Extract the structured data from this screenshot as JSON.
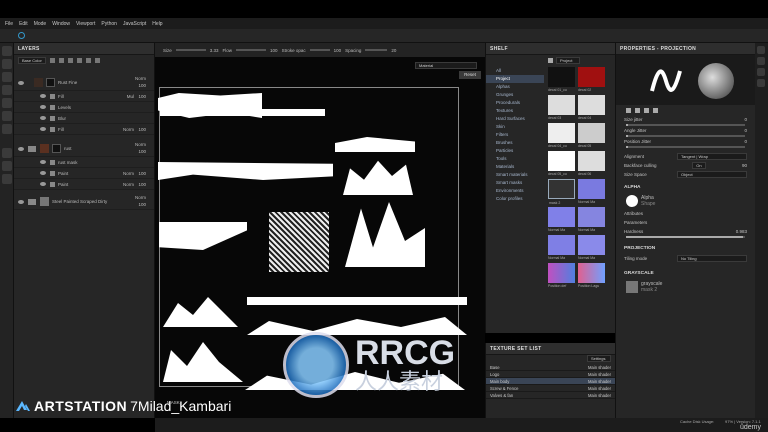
{
  "menu": [
    "File",
    "Edit",
    "Mode",
    "Window",
    "Viewport",
    "Python",
    "JavaScript",
    "Help"
  ],
  "toolbar": {
    "size_label": "Size",
    "size_value": "3.33",
    "flow_label": "Flow",
    "flow_value": "100",
    "stroke_label": "Stroke opac",
    "stroke_value": "100",
    "spacing_label": "Spacing",
    "spacing_value": "20"
  },
  "layers": {
    "title": "LAYERS",
    "blend": "Base Color",
    "items": [
      {
        "name": "Rust Fine",
        "mode": "Norm",
        "opacity": "100",
        "type": "fill"
      },
      {
        "name": "Fill",
        "mode": "Mul",
        "opacity": "100",
        "type": "sub"
      },
      {
        "name": "Levels",
        "mode": "",
        "opacity": "",
        "type": "sub"
      },
      {
        "name": "Blur",
        "mode": "",
        "opacity": "",
        "type": "sub"
      },
      {
        "name": "Fill",
        "mode": "Norm",
        "opacity": "100",
        "type": "sub"
      },
      {
        "name": "rust",
        "mode": "Norm",
        "opacity": "100",
        "type": "folder"
      },
      {
        "name": "rust mask",
        "mode": "",
        "opacity": "",
        "type": "sub"
      },
      {
        "name": "Paint",
        "mode": "Norm",
        "opacity": "100",
        "type": "sub"
      },
      {
        "name": "Paint",
        "mode": "Norm",
        "opacity": "100",
        "type": "sub"
      },
      {
        "name": "Steel Painted Scraped Dirty",
        "mode": "Norm",
        "opacity": "100",
        "type": "folder"
      }
    ]
  },
  "viewport": {
    "mode": "Material",
    "reset": "Reset",
    "mask_label": "MASK"
  },
  "shelf": {
    "title": "SHELF",
    "search": "Project",
    "categories": [
      "All",
      "Project",
      "Alphas",
      "Grunges",
      "Procedurals",
      "Textures",
      "Hard Surfaces",
      "Skin",
      "Filters",
      "Brushes",
      "Particles",
      "Tools",
      "Materials",
      "Smart materials",
      "Smart masks",
      "Environments",
      "Color profiles"
    ],
    "selected": "Project",
    "items": [
      "decal 01_cu",
      "decal 02",
      "decal 03",
      "decal 04",
      "decal 04_cu",
      "decal 05",
      "decal 05_cu",
      "decal 06",
      "mask 2",
      "Normal Ma",
      "Normal Ma",
      "Normal Ma",
      "Normal Ma",
      "Normal Ma",
      "Position def",
      "Position Lagu",
      "Position def",
      "Position def"
    ]
  },
  "texture_sets": {
    "title": "TEXTURE SET LIST",
    "settings": "Settings",
    "rows": [
      {
        "name": "Base",
        "shader": "Main shader"
      },
      {
        "name": "Logo",
        "shader": "Main shader"
      },
      {
        "name": "Main body",
        "shader": "Main shader"
      },
      {
        "name": "Screw & Fence",
        "shader": "Main shader"
      },
      {
        "name": "Valves & fan",
        "shader": "Main shader"
      }
    ]
  },
  "properties": {
    "title": "PROPERTIES - PROJECTION",
    "size_jitter": "Size jitter",
    "size_jitter_value": "0",
    "angle_jitter": "Angle Jitter",
    "angle_jitter_value": "0",
    "position_jitter": "Position Jitter",
    "position_jitter_value": "0",
    "alignment": "Alignment",
    "alignment_value": "Tangent | Wrap",
    "backface": "Backface culling",
    "backface_value": "On",
    "backface_num": "90",
    "size_space": "Size Space",
    "size_space_value": "Object",
    "alpha_section": "ALPHA",
    "alpha_name": "Alpha",
    "alpha_sub": "Shape",
    "attributes": "Attributes",
    "parameters": "Parameters",
    "hardness": "Hardness",
    "hardness_value": "0.983",
    "projection_section": "PROJECTION",
    "tiling": "Tiling mode",
    "tiling_value": "No Tiling",
    "grayscale_section": "GRAYSCALE",
    "grayscale_name": "grayscale",
    "grayscale_sub": "mask 2"
  },
  "status": {
    "cache": "Cache Disk Usage:",
    "version": "97% | Version: 7.1.1"
  },
  "watermark": {
    "artstation": "ARTSTATION",
    "credit": "7Milad_Kambari",
    "rrcg": "RRCG",
    "rrcg_sub": "人人素材",
    "udemy": "ûdemy"
  }
}
